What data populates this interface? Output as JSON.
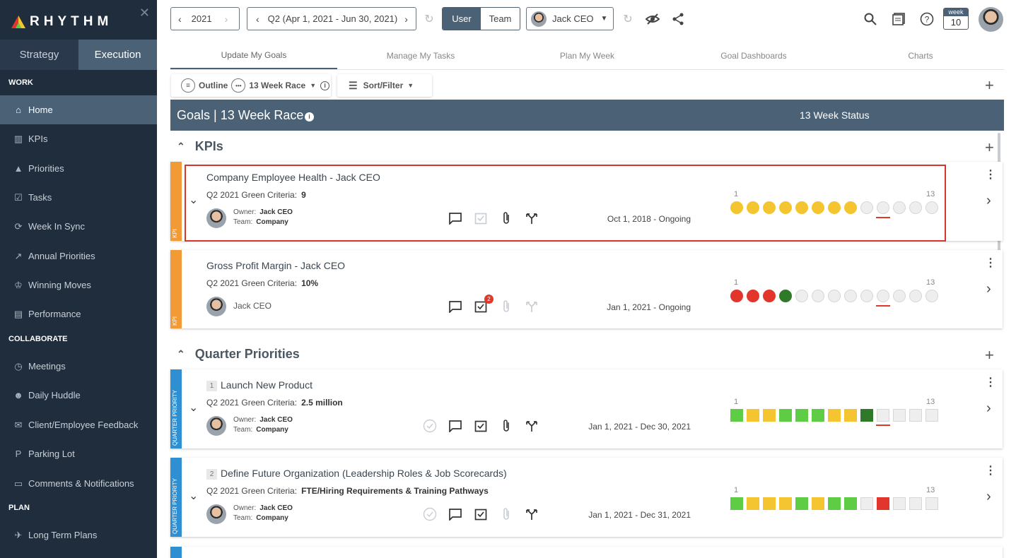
{
  "app": {
    "name": "RHYTHM"
  },
  "sidebar": {
    "modes": [
      "Strategy",
      "Execution"
    ],
    "sections": {
      "work": "WORK",
      "collaborate": "COLLABORATE",
      "plan": "PLAN"
    },
    "items": [
      {
        "label": "Home",
        "icon": "home-icon"
      },
      {
        "label": "KPIs",
        "icon": "bar-chart-icon"
      },
      {
        "label": "Priorities",
        "icon": "pyramid-icon"
      },
      {
        "label": "Tasks",
        "icon": "checkbox-icon"
      },
      {
        "label": "Week In Sync",
        "icon": "sync-icon"
      },
      {
        "label": "Annual Priorities",
        "icon": "trend-icon"
      },
      {
        "label": "Winning Moves",
        "icon": "trophy-icon"
      },
      {
        "label": "Performance",
        "icon": "briefcase-icon"
      },
      {
        "label": "Meetings",
        "icon": "clock-icon"
      },
      {
        "label": "Daily Huddle",
        "icon": "group-icon"
      },
      {
        "label": "Client/Employee Feedback",
        "icon": "feedback-icon"
      },
      {
        "label": "Parking Lot",
        "icon": "parking-icon"
      },
      {
        "label": "Comments & Notifications",
        "icon": "comment-icon"
      },
      {
        "label": "Long Term Plans",
        "icon": "plane-icon"
      }
    ]
  },
  "topbar": {
    "year": "2021",
    "quarter": "Q2 (Apr 1, 2021 - Jun 30, 2021)",
    "toggle": [
      "User",
      "Team"
    ],
    "user": "Jack CEO",
    "week_label": "week",
    "week_num": "10"
  },
  "tabs": [
    "Update My Goals",
    "Manage My Tasks",
    "Plan My Week",
    "Goal Dashboards",
    "Charts"
  ],
  "toolbar": {
    "outline": "Outline",
    "view": "13 Week Race",
    "sort": "Sort/Filter"
  },
  "header": {
    "title": "Goals | 13 Week Race",
    "status": "13 Week Status"
  },
  "sections": {
    "kpis": "KPIs",
    "quarter": "Quarter Priorities"
  },
  "range": {
    "start": "1",
    "end": "13"
  },
  "colors": {
    "yellow": "#f5c531",
    "red": "#e2352b",
    "dgreen": "#2f7a2a",
    "green": "#5fcc45",
    "empty": "#ececec",
    "kpi": "#f29b36",
    "qp": "#2e8fd3"
  },
  "cards": [
    {
      "strip": "KPI",
      "title": "Company Employee Health - Jack CEO",
      "criteria_label": "Q2 2021 Green Criteria:",
      "criteria": "9",
      "owner_label": "Owner:",
      "owner": "Jack CEO",
      "team_label": "Team:",
      "team": "Company",
      "date": "Oct 1, 2018 - Ongoing",
      "shape": "dot",
      "weeks": [
        "yellow",
        "yellow",
        "yellow",
        "yellow",
        "yellow",
        "yellow",
        "yellow",
        "yellow",
        "empty",
        "empty",
        "empty",
        "empty",
        "empty"
      ]
    },
    {
      "strip": "KPI",
      "title": "Gross Profit Margin - Jack CEO",
      "criteria_label": "Q2 2021 Green Criteria:",
      "criteria": "10%",
      "owner": "Jack CEO",
      "date": "Jan 1, 2021 - Ongoing",
      "badge": "2",
      "shape": "dot",
      "weeks": [
        "red",
        "red",
        "red",
        "dgreen",
        "empty",
        "empty",
        "empty",
        "empty",
        "empty",
        "empty",
        "empty",
        "empty",
        "empty"
      ]
    },
    {
      "strip": "QUARTER PRIORITY",
      "num": "1",
      "title": "Launch New Product",
      "criteria_label": "Q2 2021 Green Criteria:",
      "criteria": "2.5 million",
      "owner_label": "Owner:",
      "owner": "Jack CEO",
      "team_label": "Team:",
      "team": "Company",
      "date": "Jan 1, 2021 - Dec 30, 2021",
      "shape": "sq",
      "weeks": [
        "green",
        "yellow",
        "yellow",
        "green",
        "green",
        "green",
        "yellow",
        "yellow",
        "dgreen",
        "empty",
        "empty",
        "empty",
        "empty"
      ]
    },
    {
      "strip": "QUARTER PRIORITY",
      "num": "2",
      "title": "Define Future Organization (Leadership Roles & Job Scorecards)",
      "criteria_label": "Q2 2021 Green Criteria:",
      "criteria": "FTE/Hiring Requirements & Training Pathways",
      "owner_label": "Owner:",
      "owner": "Jack CEO",
      "team_label": "Team:",
      "team": "Company",
      "date": "Jan 1, 2021 - Dec 31, 2021",
      "shape": "sq",
      "weeks": [
        "green",
        "yellow",
        "yellow",
        "yellow",
        "green",
        "yellow",
        "green",
        "green",
        "empty",
        "red",
        "empty",
        "empty",
        "empty"
      ]
    }
  ]
}
